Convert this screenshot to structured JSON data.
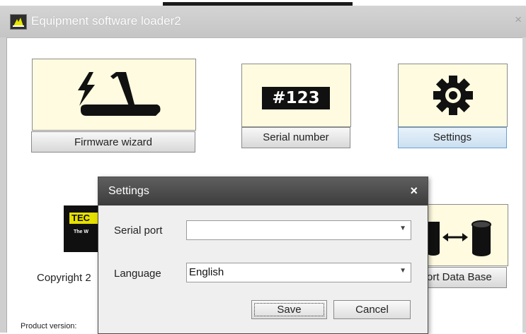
{
  "window": {
    "title": "Equipment software loader2",
    "close_glyph": "×",
    "icon": "app-logo-icon"
  },
  "tiles": {
    "firmware": {
      "label": "Firmware wizard",
      "icon": "treadmill-bolt-icon"
    },
    "serial": {
      "label": "Serial number",
      "badge": "#123",
      "icon": "serial-number-icon"
    },
    "settings": {
      "label": "Settings",
      "icon": "gear-icon"
    },
    "database": {
      "label": "ort Data Base",
      "icon": "database-sync-icon"
    }
  },
  "logo": {
    "mark": "TEC",
    "sub": "The W"
  },
  "footer": {
    "copyright": "Copyright 2",
    "product_version": "Product version:"
  },
  "dialog": {
    "title": "Settings",
    "close_glyph": "×",
    "serial_port": {
      "label": "Serial port",
      "value": ""
    },
    "language": {
      "label": "Language",
      "value": "English"
    },
    "save_label": "Save",
    "cancel_label": "Cancel"
  }
}
